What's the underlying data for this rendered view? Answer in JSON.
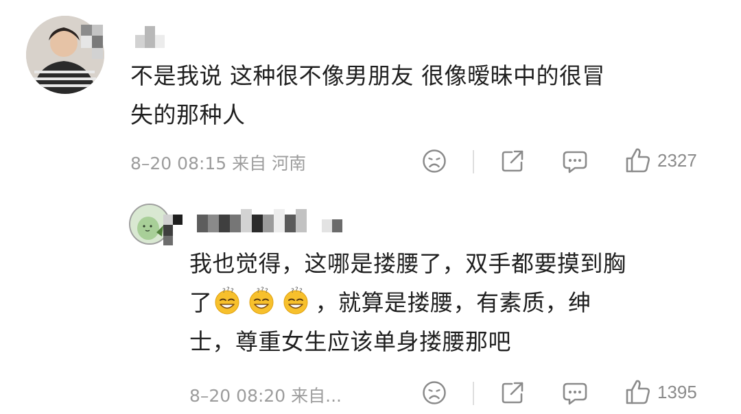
{
  "comment": {
    "text_line1": "不是我说 这种很不像男朋友 很像暧昧中的很冒",
    "text_line2": "失的那种人",
    "meta": "8–20 08:15 来自 河南",
    "like_count": "2327",
    "icons": [
      "dislike-face-icon",
      "share-icon",
      "comment-bubble-icon",
      "thumbs-up-icon"
    ]
  },
  "reply": {
    "text_line1": "我也觉得，这哪是搂腰了，双手都要摸到胸",
    "text_line2_a": "了",
    "emoji_name": "dizzy-smile-emoji",
    "emoji_count": 3,
    "text_line2_b": "，就算是搂腰，有素质，绅",
    "text_line3": "士，尊重女生应该单身搂腰那吧",
    "meta": "8–20 08:20 来自...",
    "like_count": "1395",
    "icons": [
      "dislike-face-icon",
      "share-icon",
      "comment-bubble-icon",
      "thumbs-up-icon"
    ]
  },
  "colors": {
    "text": "#1f1f1f",
    "meta": "#9c9c9c",
    "icon": "#8a8a8a",
    "avatar2_bg": "#c9dcc3"
  }
}
